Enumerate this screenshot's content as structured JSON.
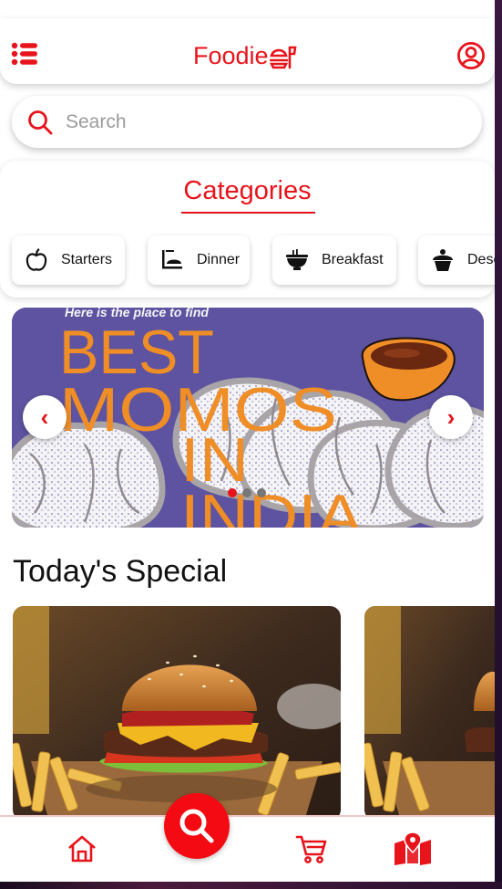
{
  "app": {
    "title": "Foodie"
  },
  "search": {
    "placeholder": "Search"
  },
  "categories": {
    "title": "Categories",
    "items": [
      {
        "label": "Starters",
        "icon": "apple-icon"
      },
      {
        "label": "Dinner",
        "icon": "dinner-icon"
      },
      {
        "label": "Breakfast",
        "icon": "bowl-icon"
      },
      {
        "label": "Dese",
        "icon": "cupcake-icon"
      }
    ]
  },
  "banner": {
    "tagline": "Here is the place to find",
    "headline_lines": [
      "BEST",
      "MOMOS",
      "IN",
      "INDIA"
    ],
    "prev": "‹",
    "next": "›",
    "slides": 3,
    "active_slide": 1
  },
  "specials": {
    "title": "Today's Special"
  },
  "nav": {
    "items": [
      "home-icon",
      "search-icon",
      "cart-icon",
      "map-icon"
    ]
  },
  "colors": {
    "accent": "#e8141c",
    "banner_bg": "#5d53a0",
    "banner_text": "#ef8d26"
  }
}
